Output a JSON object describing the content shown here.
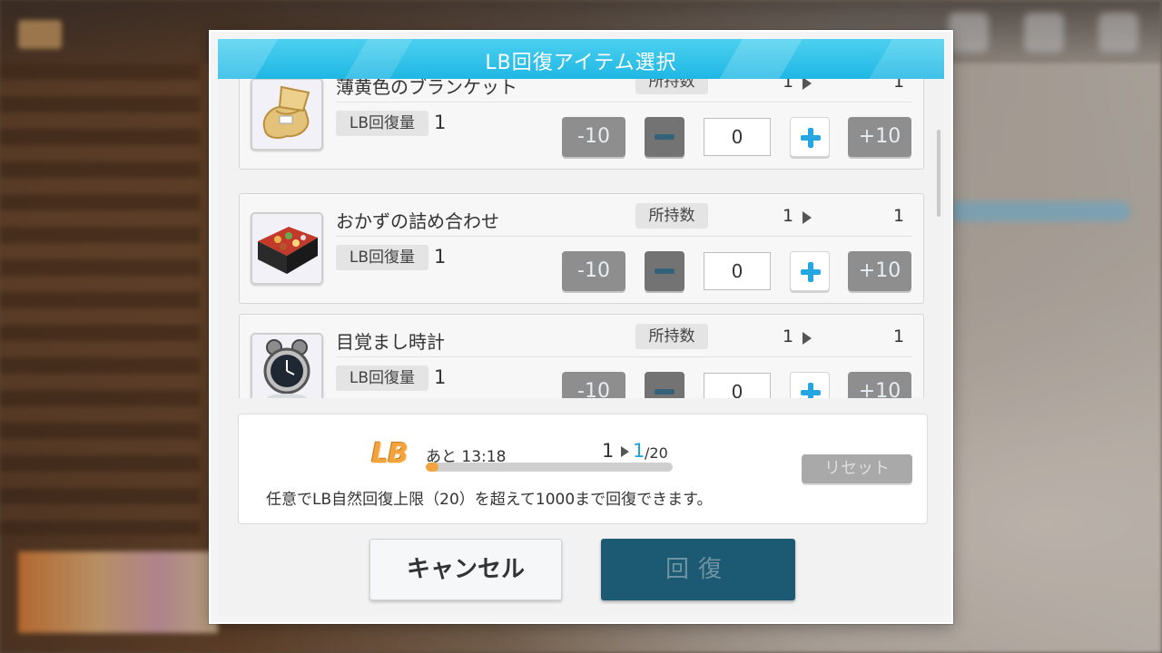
{
  "dialog": {
    "title": "LB回復アイテム選択"
  },
  "items": [
    {
      "name": "薄黄色のブランケット",
      "icon": "blanket-icon",
      "owned_label": "所持数",
      "owned_from": "1",
      "owned_to": "1",
      "recovery_label": "LB回復量",
      "recovery_value": "1",
      "minus10_label": "-10",
      "plus10_label": "+10",
      "quantity": "0"
    },
    {
      "name": "おかずの詰め合わせ",
      "icon": "bento-box-icon",
      "owned_label": "所持数",
      "owned_from": "1",
      "owned_to": "1",
      "recovery_label": "LB回復量",
      "recovery_value": "1",
      "minus10_label": "-10",
      "plus10_label": "+10",
      "quantity": "0"
    },
    {
      "name": "目覚まし時計",
      "icon": "alarm-clock-icon",
      "owned_label": "所持数",
      "owned_from": "1",
      "owned_to": "1",
      "recovery_label": "LB回復量",
      "recovery_value": "1",
      "minus10_label": "-10",
      "plus10_label": "+10",
      "quantity": "0"
    }
  ],
  "summary": {
    "lb_logo": "LB",
    "time_remaining": "あと 13:18",
    "lb_from": "1",
    "lb_to": "1",
    "lb_max": "/20",
    "progress_fraction": 0.05,
    "reset_label": "リセット",
    "notice": "任意でLB自然回復上限（20）を超えて1000まで回復できます。"
  },
  "buttons": {
    "cancel_label": "キャンセル",
    "recover_label": "回復"
  },
  "colors": {
    "title_bar": "#1fb7e4",
    "lb_accent": "#f3a33c",
    "plus_accent": "#24a7e0",
    "recover_button": "#1b5a72"
  }
}
